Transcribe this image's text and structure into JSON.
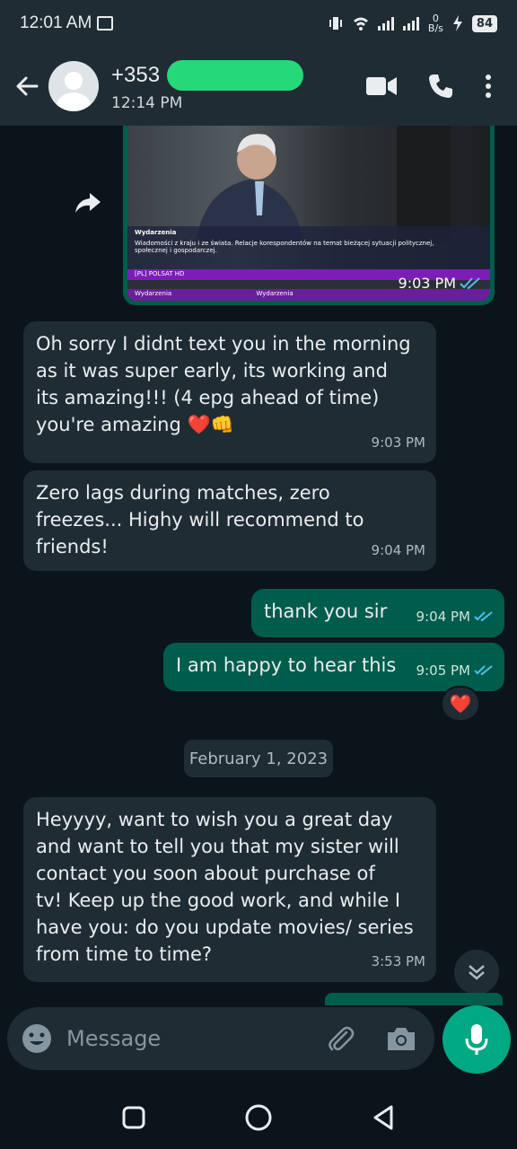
{
  "status_bar": {
    "time": "12:01 AM",
    "net_speed_value": "0",
    "net_speed_unit": "B/s",
    "battery": "84"
  },
  "header": {
    "contact_name": "+353",
    "last_seen": "12:14 PM"
  },
  "messages": [
    {
      "type": "media",
      "direction": "out",
      "time": "9:03 PM",
      "status": "read",
      "overlay": {
        "tag": "Wydarzenia",
        "ticker": "Wiadomości z kraju i ze świata. Relacje korespondentów na temat bieżącej sytuacji politycznej, społecznej i gospodarczej.",
        "channel": "[PL] POLSAT HD",
        "prog_1": "Wydarzenia",
        "prog_2": "Wydarzenia"
      }
    },
    {
      "type": "text",
      "direction": "in",
      "text_line_1": "Oh sorry I didnt text you in the morning",
      "text_line_2": "as it was super early, its working and",
      "text_line_3": "its amazing!!! (4 epg ahead of time)",
      "text_line_4": "you're amazing ❤️👊",
      "time": "9:03 PM"
    },
    {
      "type": "text",
      "direction": "in",
      "text_line_1": "Zero lags during matches, zero",
      "text_line_2": "freezes... Highy will recommend to",
      "text_line_3": "friends!",
      "time": "9:04 PM"
    },
    {
      "type": "text",
      "direction": "out",
      "text": "thank you sir",
      "time": "9:04 PM",
      "status": "read"
    },
    {
      "type": "text",
      "direction": "out",
      "text": "I am happy to hear this",
      "time": "9:05 PM",
      "status": "read",
      "reaction": "❤️"
    },
    {
      "type": "date",
      "text": "February 1, 2023"
    },
    {
      "type": "text",
      "direction": "in",
      "text_line_1": "Heyyyy, want to wish you a great day",
      "text_line_2": "and want to tell you that my sister will",
      "text_line_3": "contact you soon about purchase of",
      "text_line_4": "tv! Keep up the good work, and while I",
      "text_line_5": "have you: do you update movies/ series",
      "text_line_6": "from time to time?",
      "time": "3:53 PM"
    }
  ],
  "composer": {
    "placeholder": "Message"
  },
  "icons": {
    "back": "arrow-left-icon",
    "video": "video-call-icon",
    "call": "phone-icon",
    "menu": "more-vert-icon",
    "emoji": "emoji-icon",
    "attach": "paperclip-icon",
    "camera": "camera-icon",
    "mic": "mic-icon"
  },
  "colors": {
    "header_bg": "#1f2c34",
    "chat_bg": "#0b141a",
    "incoming_bubble": "#202c33",
    "outgoing_bubble": "#005c4b",
    "accent": "#00a884",
    "read_tick": "#53bdeb"
  }
}
